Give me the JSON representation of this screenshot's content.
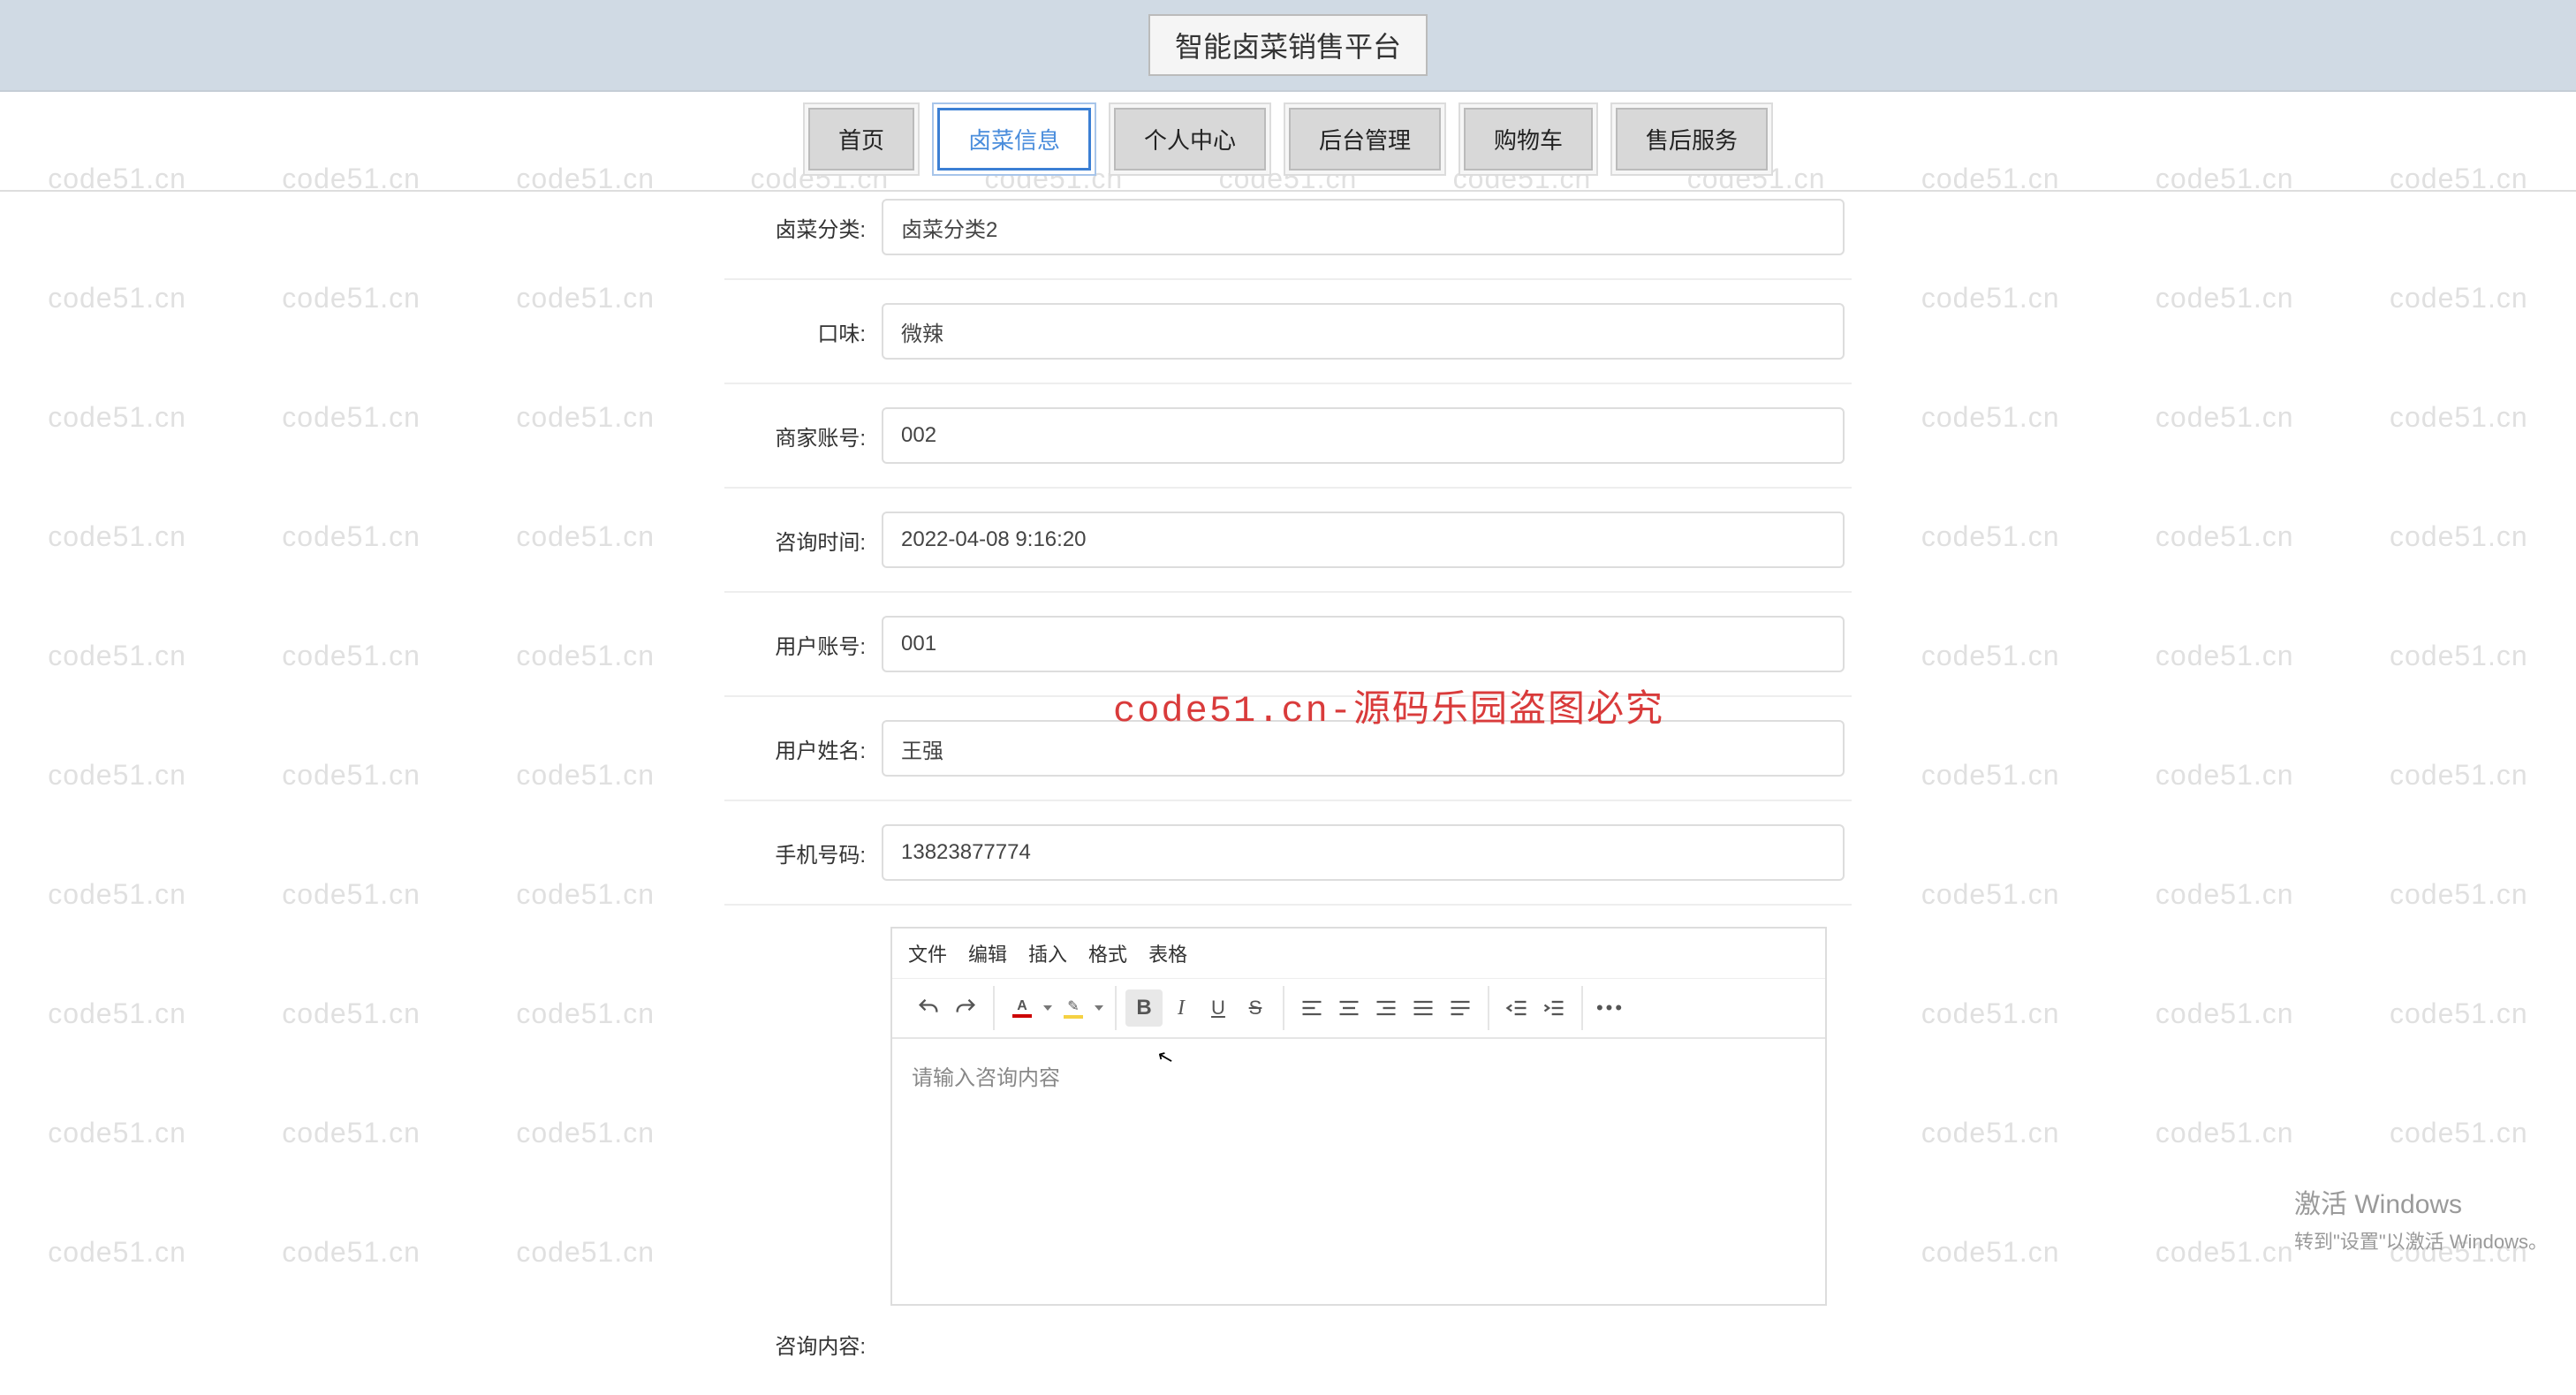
{
  "watermark": "code51.cn",
  "header": {
    "title": "智能卤菜销售平台"
  },
  "nav": {
    "items": [
      {
        "key": "home",
        "label": "首页"
      },
      {
        "key": "info",
        "label": "卤菜信息",
        "active": true
      },
      {
        "key": "personal",
        "label": "个人中心"
      },
      {
        "key": "admin",
        "label": "后台管理"
      },
      {
        "key": "cart",
        "label": "购物车"
      },
      {
        "key": "service",
        "label": "售后服务"
      }
    ]
  },
  "form": {
    "category": {
      "label": "卤菜分类:",
      "value": "卤菜分类2"
    },
    "taste": {
      "label": "口味:",
      "value": "微辣"
    },
    "merchant": {
      "label": "商家账号:",
      "value": "002"
    },
    "time": {
      "label": "咨询时间:",
      "value": "2022-04-08 9:16:20"
    },
    "user": {
      "label": "用户账号:",
      "value": "001"
    },
    "username": {
      "label": "用户姓名:",
      "value": "王强"
    },
    "phone": {
      "label": "手机号码:",
      "value": "13823877774"
    },
    "content_label": "咨询内容:"
  },
  "editor": {
    "menus": {
      "file": "文件",
      "edit": "编辑",
      "insert": "插入",
      "format": "格式",
      "table": "表格"
    },
    "placeholder": "请输入咨询内容"
  },
  "overlay": "code51.cn-源码乐园盗图必究",
  "windows": {
    "line1": "激活 Windows",
    "line2": "转到\"设置\"以激活 Windows。"
  }
}
